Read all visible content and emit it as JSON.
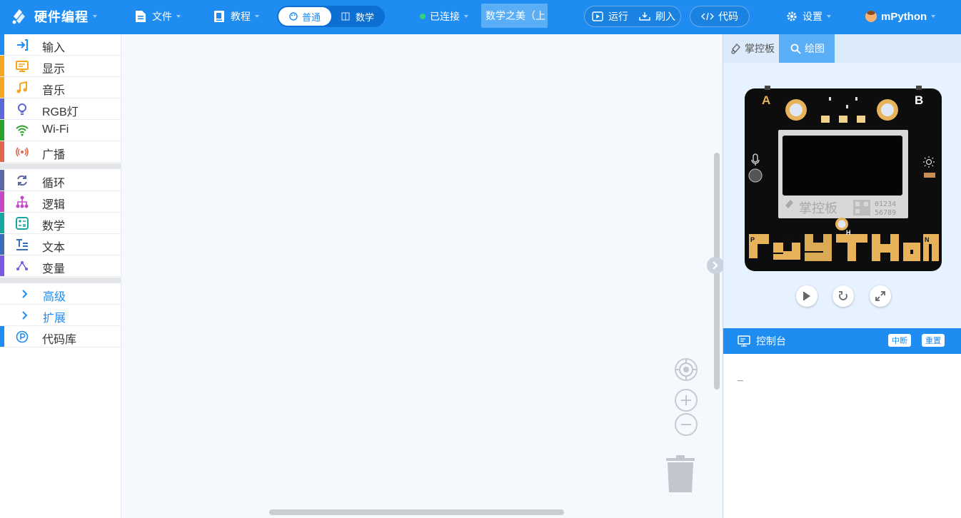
{
  "app": {
    "title": "硬件编程",
    "colors": {
      "primary": "#1e8cf0",
      "sidebar_bg": "#ffffff",
      "workspace_bg": "#f5f8fd",
      "connected": "#35d07f"
    }
  },
  "toolbar": {
    "file_label": "文件",
    "tutorial_label": "教程",
    "mode_normal": "普通",
    "mode_math": "数学",
    "connection_status": "已连接",
    "firmware_label": "数学之美（上",
    "run_label": "运行",
    "flash_label": "刷入",
    "code_label": "代码",
    "settings_label": "设置",
    "user_name": "mPython"
  },
  "sidebar": {
    "group1": [
      {
        "label": "输入",
        "color": "#1e8cf0",
        "icon": "input-icon"
      },
      {
        "label": "显示",
        "color": "#f5a623",
        "icon": "display-icon"
      },
      {
        "label": "音乐",
        "color": "#f5a623",
        "icon": "music-icon"
      },
      {
        "label": "RGB灯",
        "color": "#5b67d8",
        "icon": "bulb-icon"
      },
      {
        "label": "Wi-Fi",
        "color": "#2aa12a",
        "icon": "wifi-icon"
      },
      {
        "label": "广播",
        "color": "#e0674c",
        "icon": "broadcast-icon"
      }
    ],
    "group2": [
      {
        "label": "循环",
        "color": "#5b67a6",
        "icon": "loop-icon"
      },
      {
        "label": "逻辑",
        "color": "#c549c7",
        "icon": "logic-icon"
      },
      {
        "label": "数学",
        "color": "#19a8a0",
        "icon": "math-icon"
      },
      {
        "label": "文本",
        "color": "#3b6cb7",
        "icon": "text-icon"
      },
      {
        "label": "变量",
        "color": "#7a5ae0",
        "icon": "variable-icon"
      }
    ],
    "advanced_label": "高级",
    "extension_label": "扩展",
    "library_label": "代码库",
    "library_color": "#1e8cf0"
  },
  "right_panel": {
    "tab_board": "掌控板",
    "tab_draw": "绘图",
    "board": {
      "label_a": "A",
      "label_b": "B",
      "brand": "掌控板",
      "qr_text_1": "01234",
      "qr_text_2": "56789",
      "pin_labels": [
        "P",
        "Y",
        "T",
        "H",
        "O",
        "N"
      ]
    },
    "console_title": "控制台",
    "console_interrupt": "中断",
    "console_reset": "重置",
    "console_output": "_"
  }
}
